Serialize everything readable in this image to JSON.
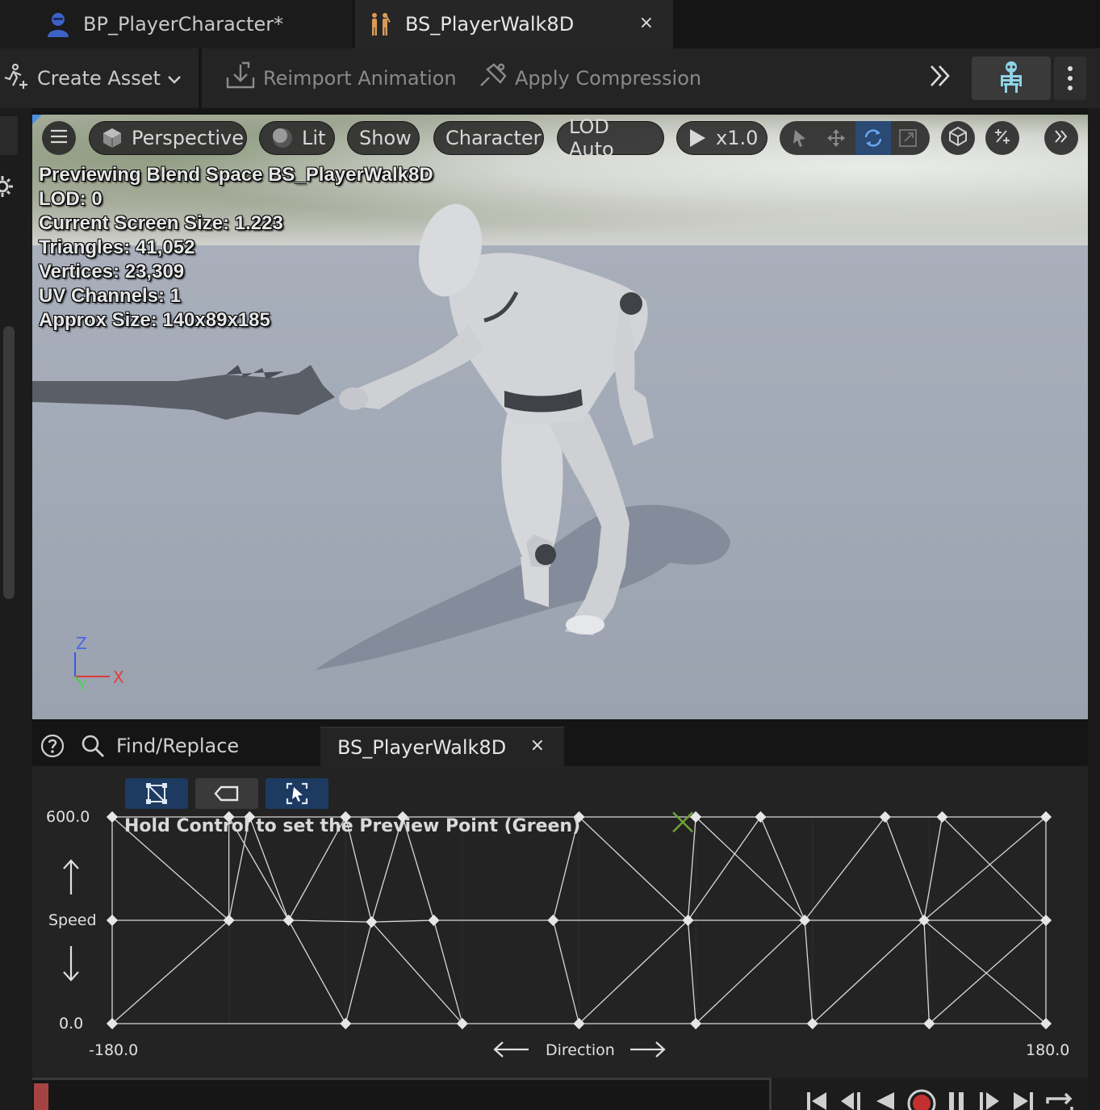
{
  "tabs": [
    {
      "label": "BP_PlayerCharacter*",
      "icon": "character-blueprint-icon"
    },
    {
      "label": "BS_PlayerWalk8D",
      "icon": "blend-space-icon",
      "close": "×"
    }
  ],
  "toolbar": {
    "create_asset": "Create Asset",
    "reimport": "Reimport Animation",
    "apply_compression": "Apply Compression"
  },
  "viewport": {
    "menu_icon": "hamburger-icon",
    "perspective": "Perspective",
    "lit": "Lit",
    "show": "Show",
    "character": "Character",
    "lod": "LOD Auto",
    "play_rate": "x1.0",
    "stats": [
      "Previewing Blend Space BS_PlayerWalk8D",
      "LOD: 0",
      "Current Screen Size: 1.223",
      "Triangles: 41,052",
      "Vertices: 23,309",
      "UV Channels: 1",
      "Approx Size: 140x89x185"
    ],
    "axes": {
      "z": "Z",
      "x": "X",
      "y": "Y"
    }
  },
  "lower_tabs": {
    "find": "Find/Replace",
    "active": "BS_PlayerWalk8D",
    "close": "×"
  },
  "blend_space": {
    "hint": "Hold Control to set the Preview Point (Green)",
    "y_axis": {
      "label": "Speed",
      "max": "600.0",
      "min": "0.0"
    },
    "x_axis": {
      "label": "Direction",
      "min": "-180.0",
      "max": "180.0"
    },
    "samples": [
      [
        -180,
        0
      ],
      [
        -90,
        0
      ],
      [
        -45,
        0
      ],
      [
        0,
        0
      ],
      [
        45,
        0
      ],
      [
        90,
        0
      ],
      [
        135,
        0
      ],
      [
        180,
        0
      ],
      [
        -180,
        300
      ],
      [
        -135,
        300
      ],
      [
        -112,
        300
      ],
      [
        -80,
        295
      ],
      [
        -56,
        300
      ],
      [
        -10,
        300
      ],
      [
        42,
        300
      ],
      [
        87,
        300
      ],
      [
        133,
        300
      ],
      [
        180,
        300
      ],
      [
        -180,
        600
      ],
      [
        -135,
        600
      ],
      [
        -127,
        600
      ],
      [
        -90,
        600
      ],
      [
        -68,
        600
      ],
      [
        0,
        600
      ],
      [
        45,
        600
      ],
      [
        70,
        600
      ],
      [
        118,
        600
      ],
      [
        140,
        600
      ],
      [
        180,
        600
      ]
    ],
    "preview_point": [
      40,
      585
    ]
  },
  "colors": {
    "accent": "#4b8fe2",
    "preview": "#6fa534",
    "record": "#c43030"
  }
}
